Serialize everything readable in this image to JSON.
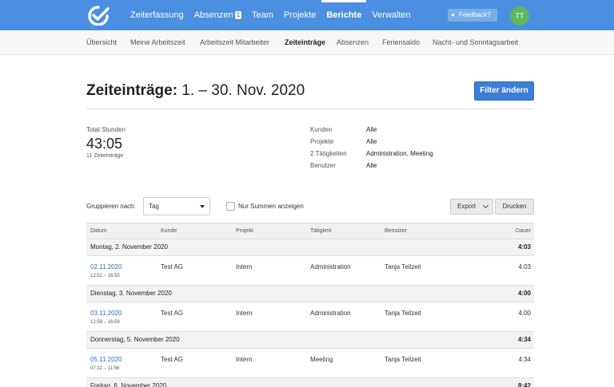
{
  "topnav": {
    "items": [
      {
        "label": "Zeiterfassung"
      },
      {
        "label": "Absenzen",
        "badge": "1"
      },
      {
        "label": "Team"
      },
      {
        "label": "Projekte"
      },
      {
        "label": "Berichte",
        "active": true
      },
      {
        "label": "Verwalten"
      }
    ],
    "feedback_label": "Feedback?",
    "avatar_initials": "TT",
    "accent_color": "#4a8fe0"
  },
  "subnav": {
    "items": [
      {
        "label": "Übersicht"
      },
      {
        "label": "Meine Arbeitszeit"
      },
      {
        "label": "Arbeitszeit Mitarbeiter"
      },
      {
        "label": "Zeiteinträge",
        "active": true
      },
      {
        "label": "Absenzen"
      },
      {
        "label": "Feriensaldo"
      },
      {
        "label": "Nacht- und Sonntagsarbeit"
      }
    ]
  },
  "header": {
    "title_bold": "Zeiteinträge:",
    "title_range": "1. – 30. Nov. 2020",
    "filter_button": "Filter ändern"
  },
  "summary": {
    "label": "Total Stunden",
    "value": "43:05",
    "count": "11 Zeiteinträge",
    "meta": [
      {
        "key": "Kunden",
        "value": "Alle"
      },
      {
        "key": "Projekte",
        "value": "Alle"
      },
      {
        "key": "2 Tätigkeiten",
        "value": "Administration, Meeting"
      },
      {
        "key": "Benutzer",
        "value": "Alle"
      }
    ]
  },
  "controls": {
    "group_label": "Gruppieren nach:",
    "group_value": "Tag",
    "sums_only_label": "Nur Summen anzeigen",
    "sums_only_checked": false,
    "export_label": "Export",
    "print_label": "Drucken"
  },
  "table": {
    "headers": {
      "date": "Datum",
      "customer": "Kunde",
      "project": "Projekt",
      "activity": "Tätigkeit",
      "user": "Benutzer",
      "duration": "Dauer"
    },
    "groups": [
      {
        "day": "Montag, 2. November 2020",
        "total": "4:03",
        "entry": {
          "date": "02.11.2020",
          "time": "12:52 – 16:55",
          "customer": "Test AG",
          "project": "Intern",
          "activity": "Administration",
          "user": "Tanja Teilzeit",
          "duration": "4:03"
        }
      },
      {
        "day": "Dienstag, 3. November 2020",
        "total": "4:00",
        "entry": {
          "date": "03.11.2020",
          "time": "12:59 – 16:59",
          "customer": "Test AG",
          "project": "Intern",
          "activity": "Administration",
          "user": "Tanja Teilzeit",
          "duration": "4:00"
        }
      },
      {
        "day": "Donnerstag, 5. November 2020",
        "total": "4:34",
        "entry": {
          "date": "05.11.2020",
          "time": "07:22 – 11:56",
          "customer": "Test AG",
          "project": "Intern",
          "activity": "Meeting",
          "user": "Tanja Teilzeit",
          "duration": "4:34"
        }
      },
      {
        "day": "Freitag, 6. November 2020",
        "total": "8:42"
      }
    ]
  }
}
